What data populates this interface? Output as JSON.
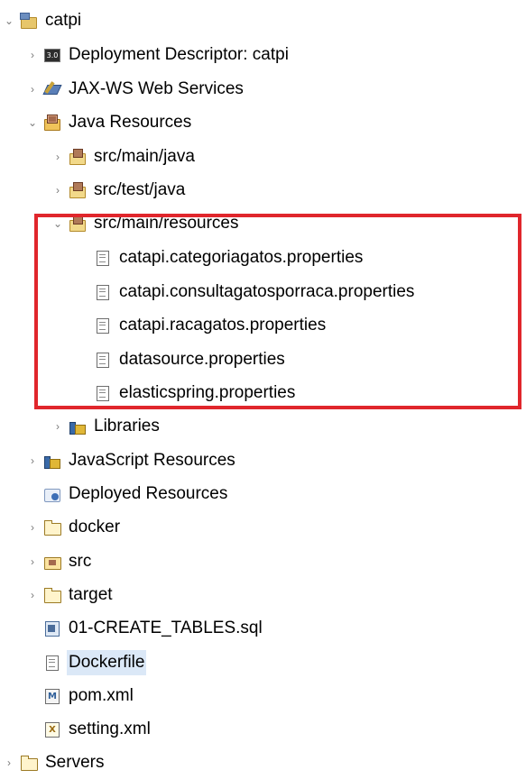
{
  "tree": {
    "nodes": [
      {
        "label": "catpi",
        "icon": "project-icon",
        "twisty": "expanded"
      },
      {
        "label": "Deployment Descriptor: catpi",
        "icon": "deployment-descriptor-icon",
        "twisty": "collapsed"
      },
      {
        "label": "JAX-WS Web Services",
        "icon": "web-services-icon",
        "twisty": "collapsed"
      },
      {
        "label": "Java Resources",
        "icon": "java-resources-icon",
        "twisty": "expanded"
      },
      {
        "label": "src/main/java",
        "icon": "source-folder-icon",
        "twisty": "collapsed"
      },
      {
        "label": "src/test/java",
        "icon": "source-folder-icon",
        "twisty": "collapsed"
      },
      {
        "label": "src/main/resources",
        "icon": "source-folder-icon",
        "twisty": "expanded"
      },
      {
        "label": "catapi.categoriagatos.properties",
        "icon": "properties-file-icon",
        "twisty": "none"
      },
      {
        "label": "catapi.consultagatosporraca.properties",
        "icon": "properties-file-icon",
        "twisty": "none"
      },
      {
        "label": "catapi.racagatos.properties",
        "icon": "properties-file-icon",
        "twisty": "none"
      },
      {
        "label": "datasource.properties",
        "icon": "properties-file-icon",
        "twisty": "none"
      },
      {
        "label": "elasticspring.properties",
        "icon": "properties-file-icon",
        "twisty": "none"
      },
      {
        "label": "Libraries",
        "icon": "libraries-icon",
        "twisty": "collapsed"
      },
      {
        "label": "JavaScript Resources",
        "icon": "libraries-icon",
        "twisty": "collapsed"
      },
      {
        "label": "Deployed Resources",
        "icon": "deployed-resources-icon",
        "twisty": "none"
      },
      {
        "label": "docker",
        "icon": "folder-icon",
        "twisty": "collapsed"
      },
      {
        "label": "src",
        "icon": "src-folder-icon",
        "twisty": "collapsed"
      },
      {
        "label": "target",
        "icon": "folder-icon",
        "twisty": "collapsed"
      },
      {
        "label": "01-CREATE_TABLES.sql",
        "icon": "sql-file-icon",
        "twisty": "none"
      },
      {
        "label": "Dockerfile",
        "icon": "file-icon",
        "twisty": "none",
        "selected": true
      },
      {
        "label": "pom.xml",
        "icon": "maven-pom-icon",
        "twisty": "none"
      },
      {
        "label": "setting.xml",
        "icon": "xml-file-icon",
        "twisty": "none"
      },
      {
        "label": "Servers",
        "icon": "folder-icon",
        "twisty": "collapsed"
      }
    ]
  },
  "glyphs": {
    "expanded": "⌄",
    "collapsed": "›"
  },
  "highlight": {
    "color": "#e0262c"
  },
  "selection": {
    "color": "#dbe8f7"
  }
}
